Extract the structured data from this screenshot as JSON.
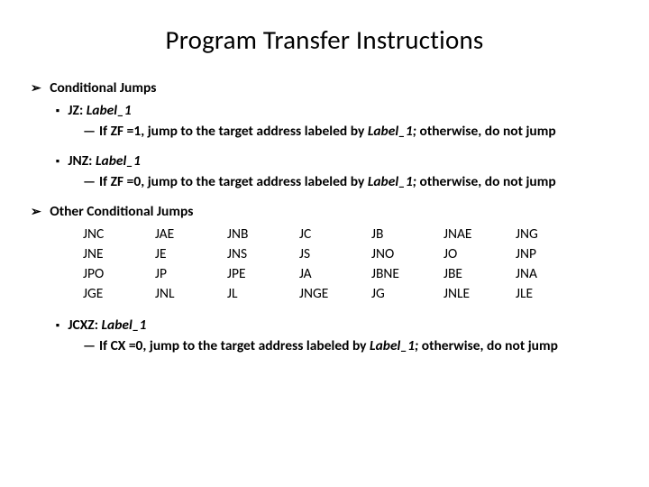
{
  "title": "Program Transfer Instructions",
  "section1": "Conditional Jumps",
  "itemA_name": "JZ: ",
  "itemA_label": "Label_1",
  "itemA_dash": "—",
  "itemA_pre": "If ZF =1, jump to the target address labeled by ",
  "itemA_mid": "Label_1;",
  "itemA_post": " otherwise, do not jump",
  "itemB_name": "JNZ: ",
  "itemB_label": "Label_1",
  "itemB_dash": "—",
  "itemB_pre": "If ZF =0, jump to the target address labeled by ",
  "itemB_mid": "Label_1;",
  "itemB_post": " otherwise, do not jump",
  "section2": "Other Conditional Jumps",
  "jump_table": [
    [
      "JNC",
      "JAE",
      "JNB",
      "JC",
      "JB",
      "JNAE",
      "JNG"
    ],
    [
      "JNE",
      "JE",
      "JNS",
      "JS",
      "JNO",
      "JO",
      "JNP"
    ],
    [
      "JPO",
      "JP",
      "JPE",
      "JA",
      "JBNE",
      "JBE",
      "JNA"
    ],
    [
      "JGE",
      "JNL",
      "JL",
      "JNGE",
      "JG",
      "JNLE",
      "JLE"
    ]
  ],
  "itemC_name": "JCXZ: ",
  "itemC_label": "Label_1",
  "itemC_dash": "—",
  "itemC_pre": "If CX =0, jump to the target address labeled by ",
  "itemC_mid": "Label_1;",
  "itemC_post": " otherwise, do not jump"
}
